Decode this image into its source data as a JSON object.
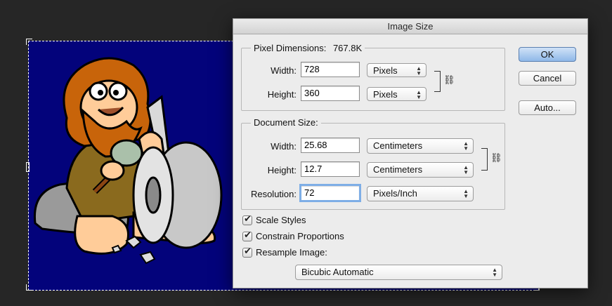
{
  "dialog": {
    "title": "Image Size",
    "buttons": {
      "ok": "OK",
      "cancel": "Cancel",
      "auto": "Auto..."
    },
    "pixel_dimensions": {
      "legend": "Pixel Dimensions:",
      "size": "767.8K",
      "width_label": "Width:",
      "width_value": "728",
      "width_unit": "Pixels",
      "height_label": "Height:",
      "height_value": "360",
      "height_unit": "Pixels"
    },
    "document_size": {
      "legend": "Document Size:",
      "width_label": "Width:",
      "width_value": "25.68",
      "width_unit": "Centimeters",
      "height_label": "Height:",
      "height_value": "12.7",
      "height_unit": "Centimeters",
      "resolution_label": "Resolution:",
      "resolution_value": "72",
      "resolution_unit": "Pixels/Inch"
    },
    "options": {
      "scale_styles": {
        "label": "Scale Styles",
        "checked": true
      },
      "constrain_proportions": {
        "label": "Constrain Proportions",
        "checked": true
      },
      "resample_image": {
        "label": "Resample Image:",
        "checked": true
      }
    },
    "resample_method": "Bicubic Automatic"
  },
  "icons": {
    "link": "chain-link-icon",
    "dropdown": "up-down-arrows-icon"
  },
  "colors": {
    "canvas_background": "#03037b",
    "ok_button": "#8fb8e8"
  }
}
